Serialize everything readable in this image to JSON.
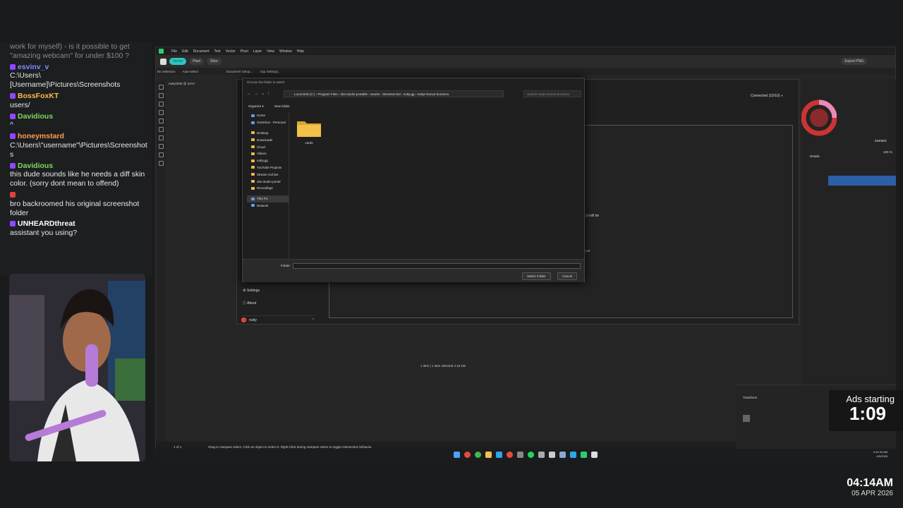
{
  "chat": {
    "messages": [
      {
        "user": "",
        "text": "work for myself) - is it possible to get \"amazing webcam\" for under $100 ?",
        "color": "#8a8a8a"
      },
      {
        "user": "esvinv_v",
        "text": "C:\\Users\\[Username]\\Pictures\\Screenshots",
        "color": "#7f8cff"
      },
      {
        "user": "BossFoxKT",
        "text": "users/",
        "color": "#ffb84d"
      },
      {
        "user": "Davidious",
        "text": "^",
        "color": "#7fd95a"
      },
      {
        "user": "honeymstard",
        "text": "C:\\Users\\\"username\"\\Pictures\\Screenshots",
        "color": "#ff9e4a"
      },
      {
        "user": "Davidious",
        "text": "this dude sounds like he needs a diff skin color. (sorry dont mean to offend)",
        "color": "#7fd95a"
      },
      {
        "user": "",
        "text": "bro backroomed his original screenshot folder",
        "color": "#e04040"
      },
      {
        "user": "UNHEARDthreat",
        "text": "assistant you using?",
        "color": "#ffffff"
      }
    ]
  },
  "app": {
    "menu": [
      "File",
      "Edit",
      "Document",
      "Text",
      "Vector",
      "Pixel",
      "Layer",
      "View",
      "Window",
      "Help"
    ],
    "persona": {
      "vector": "Vector",
      "pixel": "Pixel",
      "slice": "Slice"
    },
    "export_label": "Export PNG",
    "context": {
      "selection": "No Selection",
      "auto_select": "Auto-select",
      "doc_setup": "Document Setup...",
      "app_settings": "App Settings..."
    },
    "doc_tab": "nuttyONE @ 31%*",
    "status": {
      "page": "1 of 1",
      "hint": "Drag to marquee select. Click an object to select it. Right-Click during marquee select to toggle intersection behavior."
    }
  },
  "bgwindow": {
    "connected": "Connected (10/10)",
    "settings": "Settings",
    "about": "About",
    "user": "nutty",
    "details": "Details",
    "hex": "E8E8E8",
    "zoom": "100 %",
    "status_items": "1 item",
    "status_selected": "1 item selected  4.16 GB",
    "partial_text": "ct will be",
    "cancel_partial": "ncel"
  },
  "dialog": {
    "title": "Choose the folder to watch",
    "path": [
      "Local Disk (C:)",
      "Program Files",
      "obs-studio-portable",
      "assets",
      "Streamer.bot",
      "nutty.gg",
      "nuttys-bonus-bonanza"
    ],
    "search_placeholder": "Search nuttys-bonus-bonanza",
    "organize": "Organize",
    "new_folder": "New folder",
    "nav": [
      "Home",
      "OneDrive - Personal",
      "Desktop",
      "Downloads",
      "Cloud",
      "Videos",
      "nutty.gg",
      "YouTube Projects",
      "Stream Archive",
      "obs-studio-portal",
      "Recordings",
      "This PC",
      "Network"
    ],
    "folder_name": "cards",
    "folder_label": "Folder:",
    "select_button": "Select Folder",
    "cancel_button": "Cancel"
  },
  "overlay": {
    "ads_label": "Ads starting",
    "ads_timer": "1:09",
    "time": "04:14AM",
    "date": "05 APR 2026",
    "tray_time": "4:14:34 AM",
    "tray_date": "4/5/2026"
  },
  "colors": {
    "accent": "#2ec4c4",
    "twitch": "#9146ff",
    "folder": "#f3c04c"
  }
}
